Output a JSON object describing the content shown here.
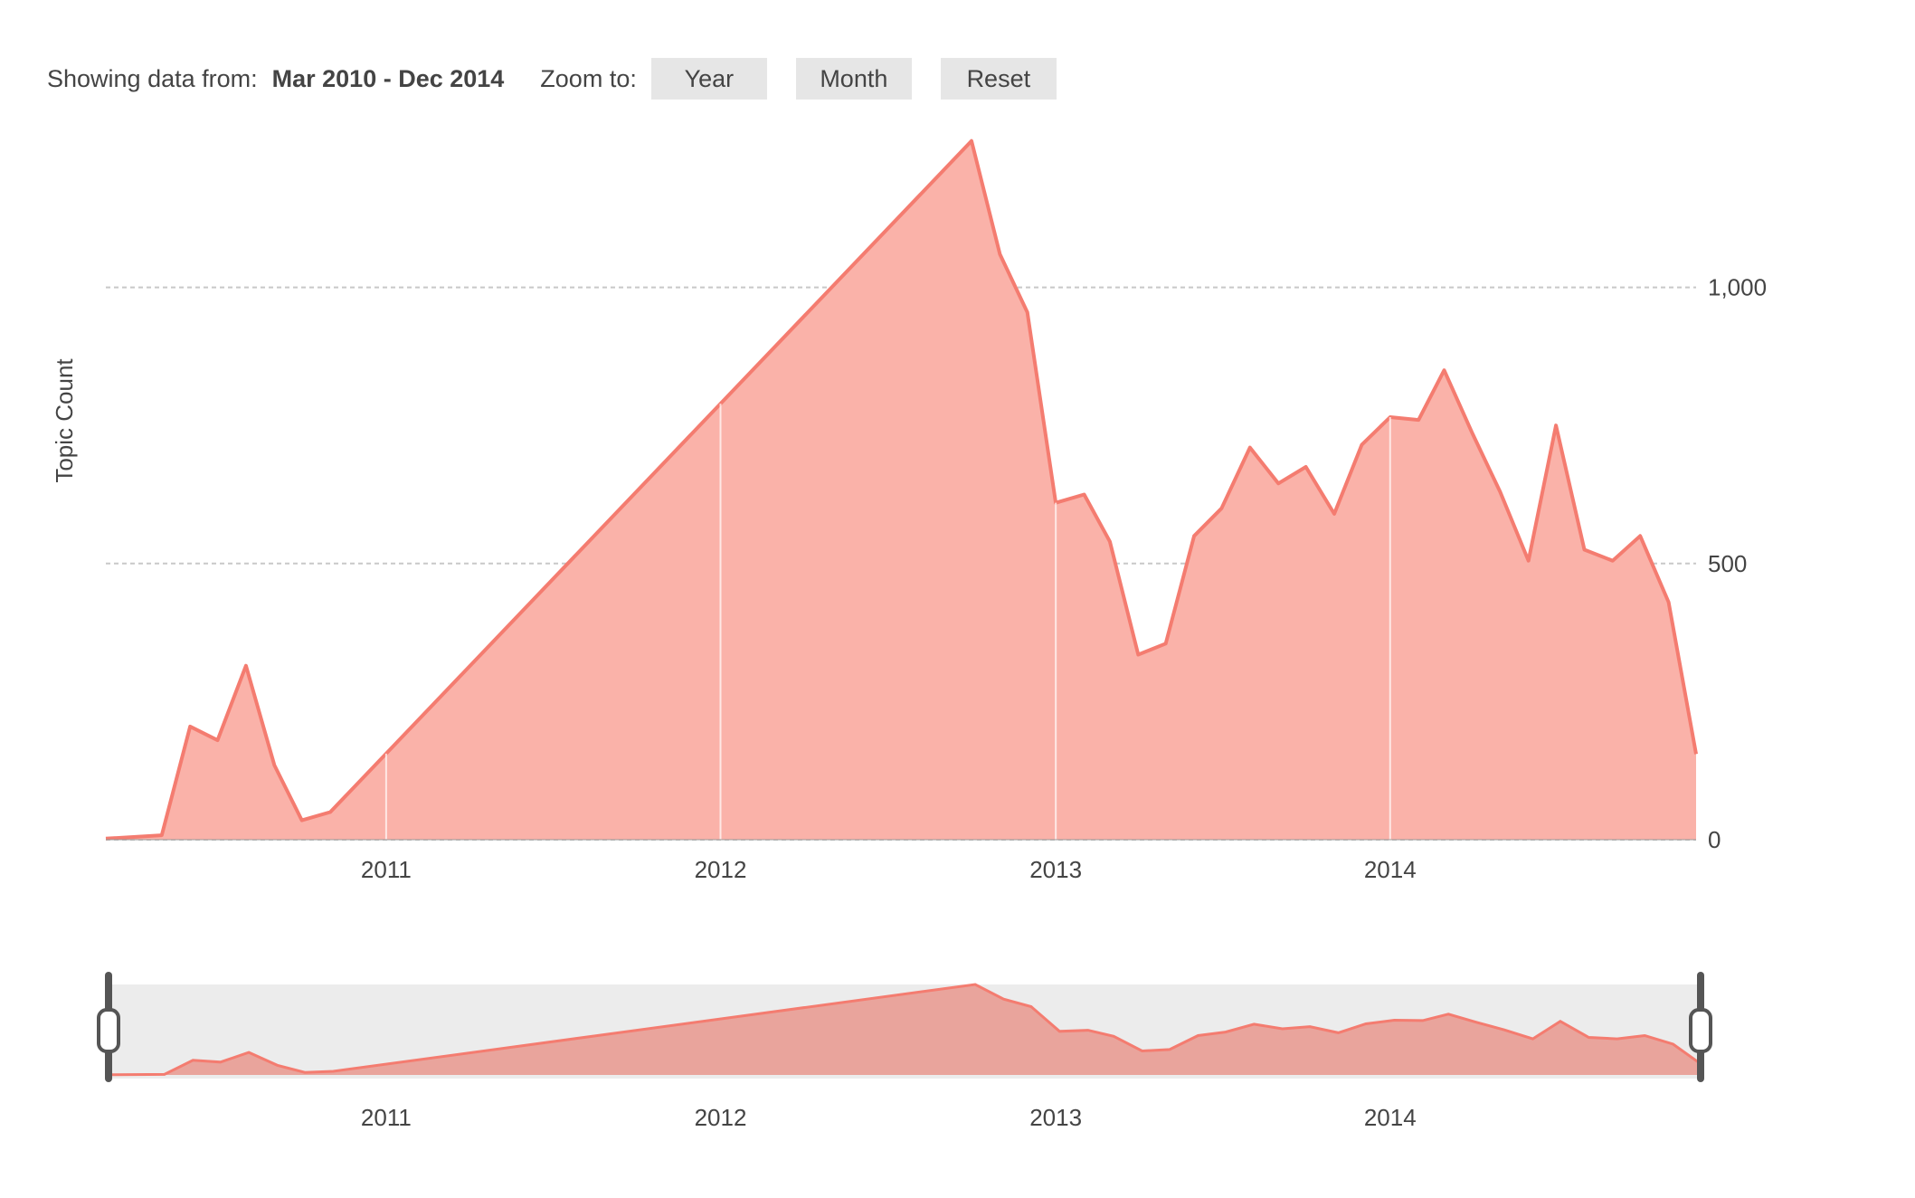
{
  "toolbar": {
    "showing_label": "Showing data from:",
    "range_text": "Mar 2010 - Dec 2014",
    "zoom_label": "Zoom to:",
    "buttons": [
      "Year",
      "Month",
      "Reset"
    ]
  },
  "colors": {
    "line": "#f47c70",
    "fill": "#fab2a9",
    "navigator_fill": "#e9a49c",
    "navigator_bg": "#ececec",
    "grid": "#c8c8c8",
    "handle": "#555555"
  },
  "chart_data": {
    "type": "area",
    "title": "",
    "xlabel": "",
    "ylabel": "Topic Count",
    "ylim": [
      0,
      1250
    ],
    "yticks": [
      0,
      500,
      1000
    ],
    "ytick_labels": [
      "0",
      "500",
      "1,000"
    ],
    "xticks": [
      "2011",
      "2012",
      "2013",
      "2014"
    ],
    "grid": true,
    "series": [
      {
        "points": [
          [
            "2010-03-01",
            2
          ],
          [
            "2010-05-01",
            8
          ],
          [
            "2010-06-01",
            205
          ],
          [
            "2010-07-01",
            180
          ],
          [
            "2010-08-01",
            315
          ],
          [
            "2010-09-01",
            135
          ],
          [
            "2010-10-01",
            35
          ],
          [
            "2010-11-01",
            50
          ],
          [
            "2012-10-01",
            1265
          ],
          [
            "2012-11-01",
            1060
          ],
          [
            "2012-12-01",
            955
          ],
          [
            "2013-01-01",
            610
          ],
          [
            "2013-02-01",
            625
          ],
          [
            "2013-03-01",
            540
          ],
          [
            "2013-04-01",
            335
          ],
          [
            "2013-05-01",
            355
          ],
          [
            "2013-06-01",
            550
          ],
          [
            "2013-07-01",
            600
          ],
          [
            "2013-08-01",
            710
          ],
          [
            "2013-09-01",
            645
          ],
          [
            "2013-10-01",
            675
          ],
          [
            "2013-11-01",
            590
          ],
          [
            "2013-12-01",
            715
          ],
          [
            "2014-01-01",
            765
          ],
          [
            "2014-02-01",
            760
          ],
          [
            "2014-03-01",
            850
          ],
          [
            "2014-04-01",
            735
          ],
          [
            "2014-05-01",
            630
          ],
          [
            "2014-06-01",
            505
          ],
          [
            "2014-07-01",
            750
          ],
          [
            "2014-08-01",
            525
          ],
          [
            "2014-09-01",
            505
          ],
          [
            "2014-10-01",
            550
          ],
          [
            "2014-11-01",
            430
          ],
          [
            "2014-12-01",
            155
          ]
        ]
      }
    ],
    "navigator": {
      "xticks": [
        "2011",
        "2012",
        "2013",
        "2014"
      ]
    }
  }
}
